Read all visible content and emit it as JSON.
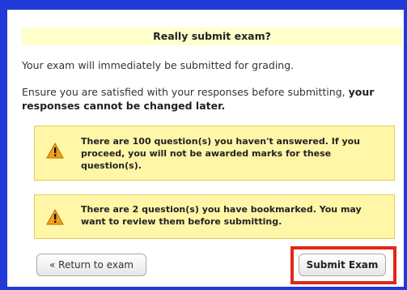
{
  "dialog": {
    "title": "Really submit exam?",
    "message_1": "Your exam will immediately be submitted for grading.",
    "message_2_prefix": "Ensure you are satisfied with your responses before submitting, ",
    "message_2_bold": "your responses cannot be changed later."
  },
  "warnings": [
    {
      "icon": "warning-triangle-icon",
      "text": "There are 100 question(s) you haven't answered. If you proceed, you will not be awarded marks for these question(s)."
    },
    {
      "icon": "warning-triangle-icon",
      "text": "There are 2 question(s) you have bookmarked. You may want to review them before submitting."
    }
  ],
  "buttons": {
    "return_label": "« Return to exam",
    "submit_label": "Submit Exam"
  },
  "colors": {
    "frame_border": "#1f3ad6",
    "header_bg": "#ffffcc",
    "warning_bg": "#fff6a8",
    "warning_border": "#e7c95b",
    "highlight": "#e0271a"
  }
}
